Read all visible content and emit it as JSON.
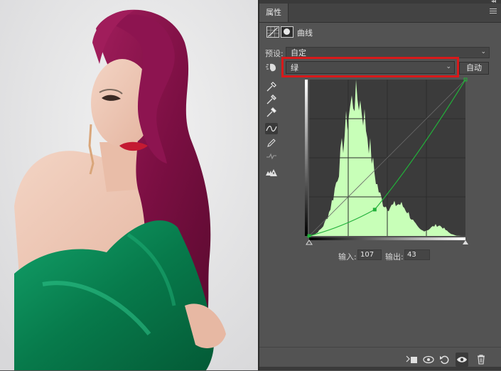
{
  "panel": {
    "tab_label": "属性",
    "collapse_glyph": "◂◂",
    "adjustment_title": "曲线"
  },
  "preset": {
    "label": "预设:",
    "value": "自定"
  },
  "channel": {
    "value": "绿",
    "auto_button": "自动"
  },
  "curve": {
    "input_label": "输入:",
    "input_value": "107",
    "output_label": "输出:",
    "output_value": "43",
    "channel_color": "#22b13a",
    "histogram_color": "#c8ffb8"
  },
  "icons": {
    "tools": [
      "sample-in-image-icon",
      "black-point-eyedropper-icon",
      "gray-point-eyedropper-icon",
      "white-point-eyedropper-icon",
      "curve-points-icon",
      "pencil-draw-icon",
      "smooth-curve-icon",
      "clipping-warning-icon"
    ],
    "bottom": [
      "clip-to-layer-icon",
      "view-previous-state-icon",
      "reset-icon",
      "visibility-icon",
      "trash-icon"
    ]
  },
  "colors": {
    "panel_bg": "#535353",
    "highlight": "#d8191a"
  }
}
